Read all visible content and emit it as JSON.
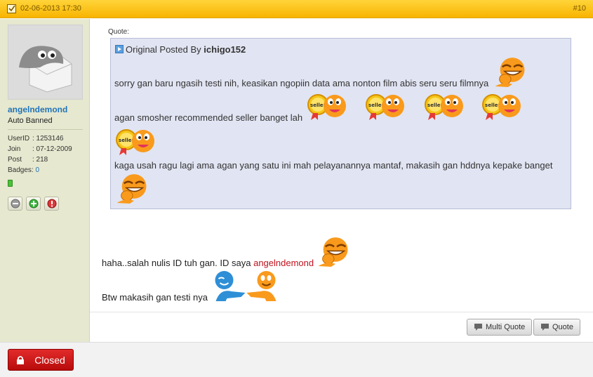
{
  "post": {
    "datetime": "02-06-2013 17:30",
    "number": "#10"
  },
  "user": {
    "name": "angelndemond",
    "status": "Auto Banned",
    "userid_label": "UserID",
    "userid": ": 1253146",
    "join_label": "Join",
    "join": ": 07-12-2009",
    "post_label": "Post",
    "post": ": 218",
    "badges_label": "Badges:",
    "badges": "0"
  },
  "quote": {
    "label": "Quote:",
    "posted_by_prefix": "Original Posted By",
    "author": "ichigo152",
    "line1": "sorry gan baru ngasih testi nih, keasikan ngopiin data ama nonton film abis seru seru filmnya",
    "line2": "agan smosher recommended seller banget lah",
    "line3": "kaga usah ragu lagi ama agan yang satu ini mah pelayanannya mantaf, makasih gan hddnya kepake banget",
    "seller_badge": "seller"
  },
  "message": {
    "line1_prefix": "haha..salah nulis ID tuh gan. ID saya",
    "line1_id": "angelndemond",
    "line2": "Btw makasih gan testi nya"
  },
  "actions": {
    "multi_quote": "Multi Quote",
    "quote": "Quote"
  },
  "thread": {
    "closed_label": "Closed"
  },
  "icons": {
    "checkbox": "checkbox-icon",
    "speech": "speech-bubble-icon",
    "lock": "lock-icon",
    "quote_arrow": "quote-arrow-icon"
  },
  "colors": {
    "header": "#f8b400",
    "sidebar": "#e6e8cf",
    "quote_bg": "#e1e4f2",
    "link": "#2274b8",
    "highlight": "#c0121d",
    "closed": "#c41414"
  }
}
